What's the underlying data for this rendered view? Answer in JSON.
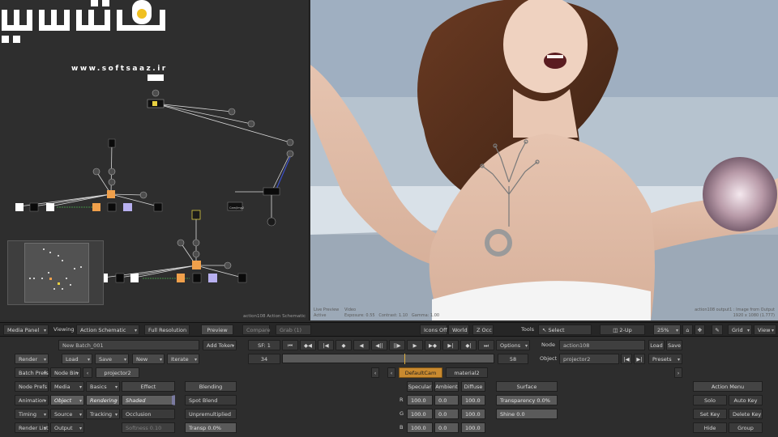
{
  "watermark": {
    "url": "www.softsaaz.ir"
  },
  "schematic": {
    "footer": "action108 Action Schematic",
    "node_labels": [
      "Cam/Img2"
    ]
  },
  "viewer": {
    "info_left": [
      "Live Preview",
      "Active"
    ],
    "info_mid": [
      "Video",
      "Exposure: 0.55",
      "Contrast: 1.10",
      "Gamma: 1.00"
    ],
    "info_right": [
      "action108 output1 : Image from Output",
      "1920 x 1080 (1.777)"
    ]
  },
  "toolbar": {
    "media_panel": "Media Panel",
    "viewing": "Viewing",
    "view_mode": "Action Schematic",
    "full_res": "Full Resolution",
    "preview": "Preview",
    "compare": "Compare",
    "grab": "Grab (1)",
    "icons_off": "Icons Off",
    "world": "World",
    "z_occ": "Z Occ",
    "tools": "Tools",
    "select": "Select",
    "two_up": "2-Up",
    "zoom": "25%",
    "grid": "Grid",
    "view": "View"
  },
  "batch": {
    "name": "New Batch_001",
    "add_token": "Add Token",
    "render": "Render",
    "load": "Load",
    "save": "Save",
    "new": "New",
    "iterate": "Iterate",
    "batch_prefs": "Batch Prefs",
    "node_bin": "Node Bin",
    "projector_tab": "projector2"
  },
  "transport": {
    "sf": "SF: 1",
    "frame_start": "34",
    "frame_end": "58",
    "options": "Options"
  },
  "node_info": {
    "node_label": "Node",
    "node_value": "action108",
    "load": "Load",
    "save": "Save",
    "object_label": "Object",
    "object_value": "projector2",
    "presets": "Presets"
  },
  "tabs": {
    "default_cam": "DefaultCam",
    "material": "material2"
  },
  "menu_left": {
    "rows": [
      [
        "Node Prefs",
        "Media",
        "Basics"
      ],
      [
        "Animation",
        "Object",
        "Rendering"
      ],
      [
        "Timing",
        "Source",
        "Tracking"
      ],
      [
        "Render List",
        "Output",
        ""
      ]
    ]
  },
  "effect": {
    "header": "Effect",
    "shaded": "Shaded",
    "occlusion": "Occlusion",
    "softness": "Softness 0.10"
  },
  "blending": {
    "header": "Blending",
    "spot_blend": "Spot Blend",
    "unpremultiplied": "Unpremultiplied",
    "transp": "Transp 0.0%"
  },
  "color_cols": {
    "headers": [
      "Specular",
      "Ambient",
      "Diffuse"
    ],
    "rows": [
      {
        "label": "R",
        "values": [
          "100.0",
          "0.0",
          "100.0"
        ]
      },
      {
        "label": "G",
        "values": [
          "100.0",
          "0.0",
          "100.0"
        ]
      },
      {
        "label": "B",
        "values": [
          "100.0",
          "0.0",
          "100.0"
        ]
      }
    ]
  },
  "surface": {
    "header": "Surface",
    "transparency": "Transparency 0.0%",
    "shine": "Shine 0.0"
  },
  "action_menu": {
    "header": "Action Menu",
    "buttons": [
      [
        "Solo",
        "Auto Key"
      ],
      [
        "Set Key",
        "Delete Key"
      ],
      [
        "Hide",
        "Group"
      ]
    ]
  },
  "colors": {
    "orange_node": "#f0a04b",
    "lavender_node": "#b8b0f0",
    "accent_tab": "#c98a2f"
  }
}
